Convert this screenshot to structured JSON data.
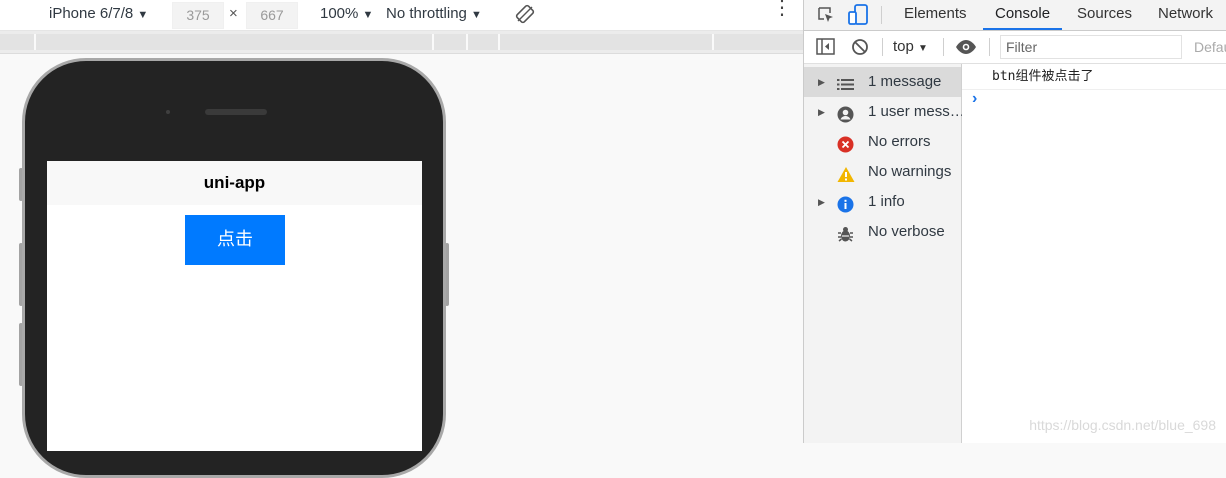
{
  "device_toolbar": {
    "device": "iPhone 6/7/8",
    "width": "375",
    "height": "667",
    "times": "×",
    "zoom": "100%",
    "throttling": "No throttling"
  },
  "app": {
    "nav_title": "uni-app",
    "button_label": "点击"
  },
  "devtools": {
    "tabs": [
      "Elements",
      "Console",
      "Sources",
      "Network"
    ],
    "active_tab": "Console",
    "context": "top",
    "filter_placeholder": "Filter",
    "default_levels": "Defau",
    "sidebar": [
      {
        "label": "1 message",
        "icon": "list-icon"
      },
      {
        "label": "1 user mess…",
        "icon": "user-icon"
      },
      {
        "label": "No errors",
        "icon": "error-icon"
      },
      {
        "label": "No warnings",
        "icon": "warning-icon"
      },
      {
        "label": "1 info",
        "icon": "info-icon"
      },
      {
        "label": "No verbose",
        "icon": "bug-icon"
      }
    ],
    "log_line": "btn组件被点击了",
    "prompt": "›"
  },
  "watermark": "https://blog.csdn.net/blue_698",
  "colors": {
    "accent": "#1a73e8",
    "button": "#007aff",
    "error": "#d93025",
    "warning": "#f2b600",
    "info": "#1a73e8"
  }
}
